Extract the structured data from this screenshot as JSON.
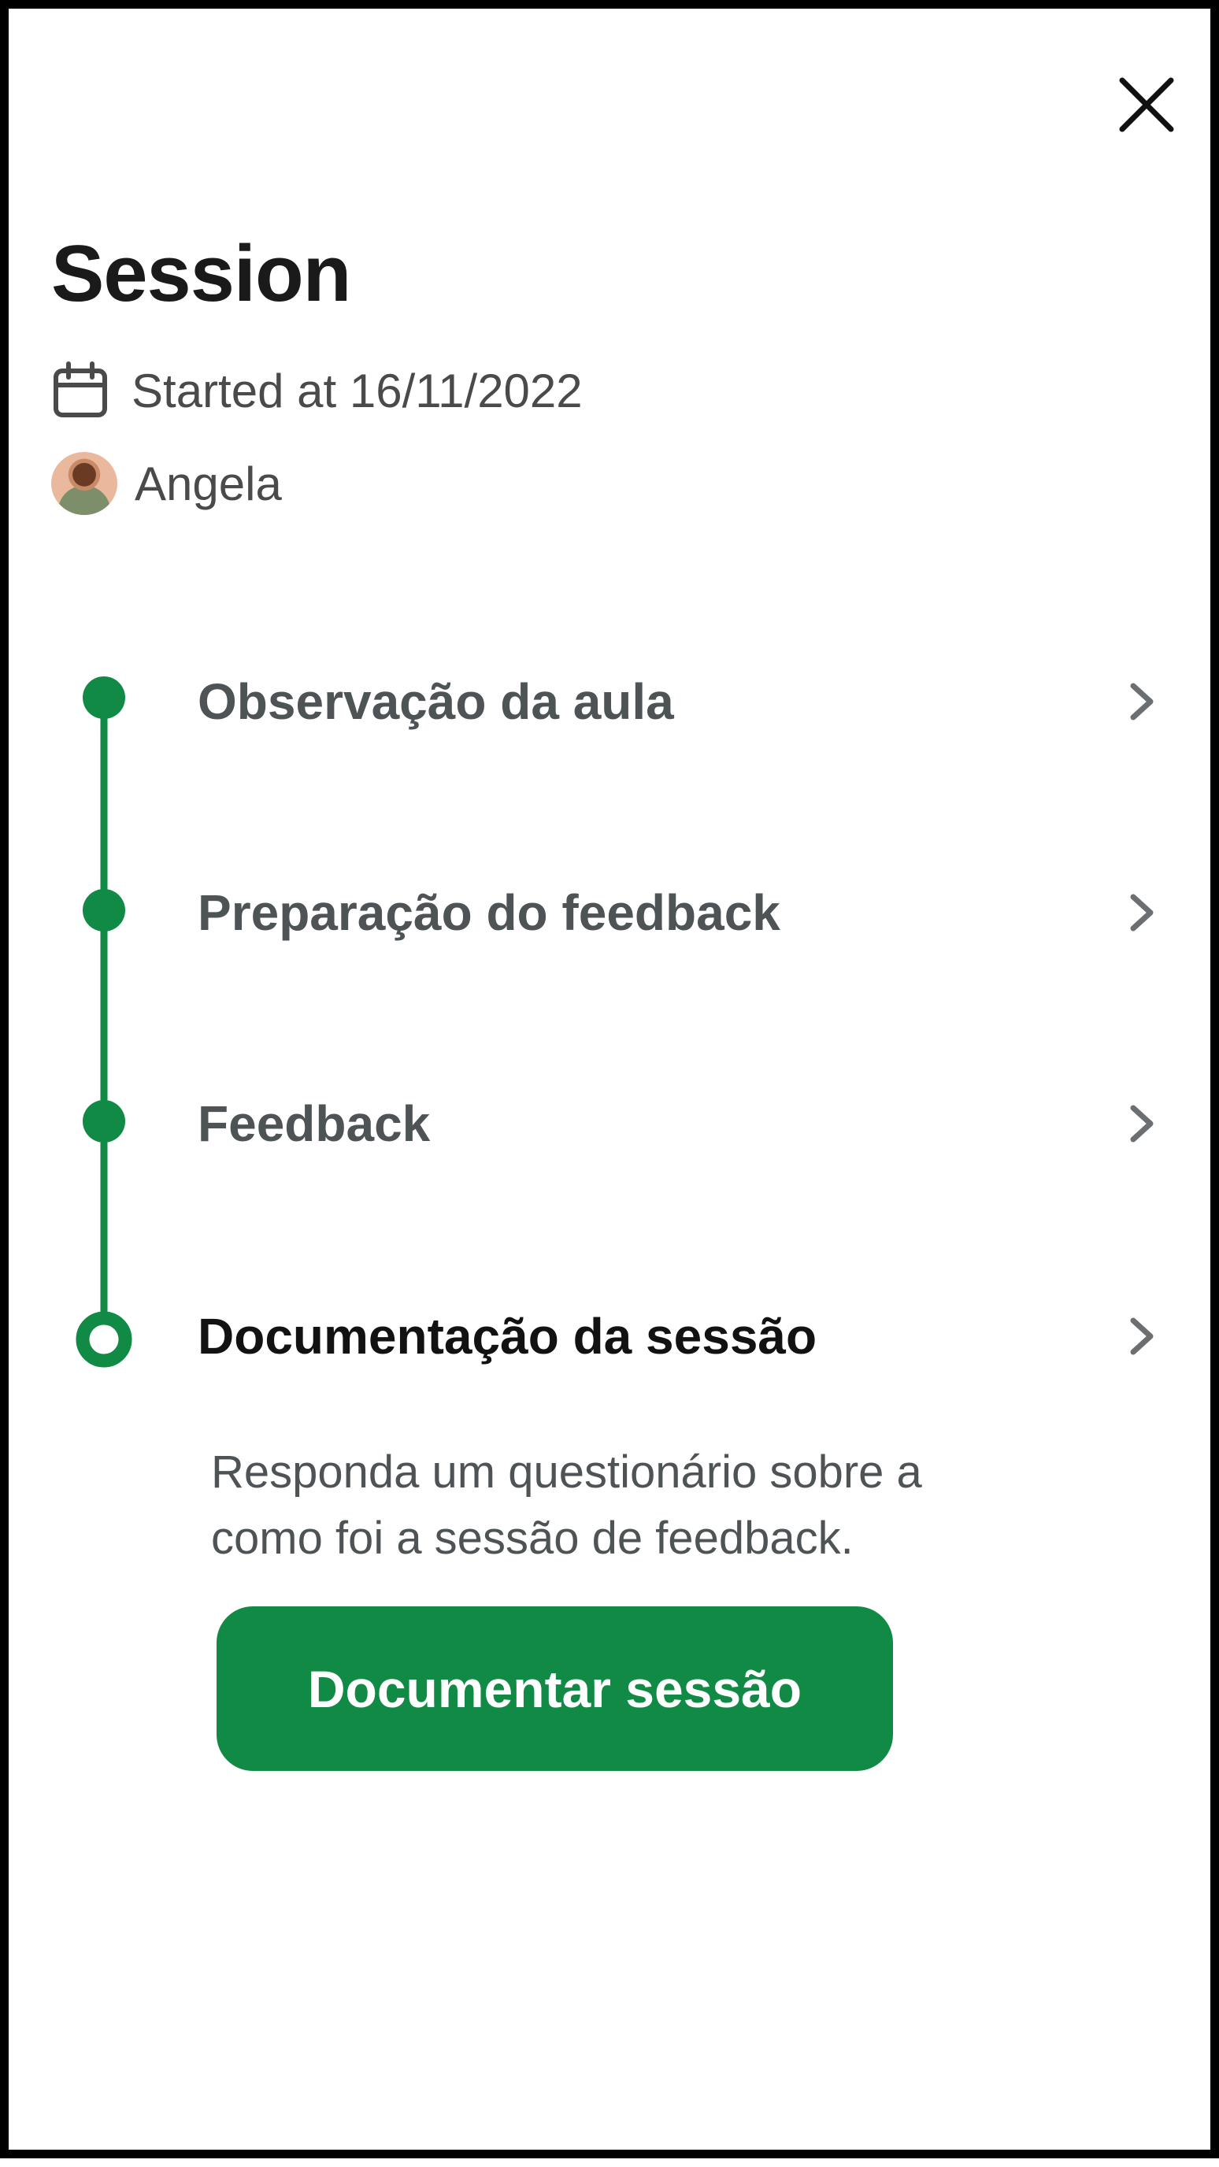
{
  "header": {
    "close_icon": "close-icon"
  },
  "session": {
    "title": "Session",
    "started_text": "Started at 16/11/2022",
    "started_icon": "calendar-icon",
    "user_name": "Angela"
  },
  "steps": [
    {
      "label": "Observação da aula",
      "status": "completed"
    },
    {
      "label": "Preparação do feedback",
      "status": "completed"
    },
    {
      "label": "Feedback",
      "status": "completed"
    },
    {
      "label": "Documentação da sessão",
      "status": "current"
    }
  ],
  "current_step": {
    "description": "Responda um questionário sobre a como foi a sessão de feedback.",
    "button_label": "Documentar sessão"
  },
  "colors": {
    "accent": "#118a45",
    "step_text": "#4e5456",
    "active_text": "#121212"
  }
}
